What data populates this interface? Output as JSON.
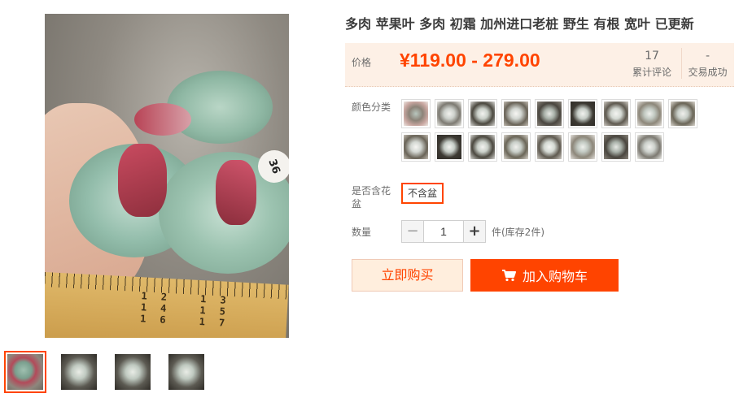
{
  "product": {
    "title": "多肉 苹果叶 多肉 初霜 加州进口老桩 野生 有根 宽叶 已更新",
    "main_image": {
      "tag_text": "36",
      "ruler_numbers": "12 13 14 15 16 17"
    }
  },
  "price": {
    "label": "价格",
    "range": "¥119.00 - 279.00",
    "reviews_count": "17",
    "reviews_label": "累计评论",
    "sales_count": "-",
    "sales_label": "交易成功"
  },
  "options": {
    "color_label": "颜色分类",
    "color_swatch_count": 17,
    "pot_label": "是否含花盆",
    "pot_value": "不含盆"
  },
  "quantity": {
    "label": "数量",
    "value": "1",
    "minus": "−",
    "plus": "+",
    "stock": "件(库存2件)"
  },
  "actions": {
    "buy_now": "立即购买",
    "add_to_cart": "加入购物车"
  },
  "colors": {
    "accent": "#ff4400",
    "price_bg": "#fdf0e6",
    "buy_now_bg": "#ffeedd"
  }
}
